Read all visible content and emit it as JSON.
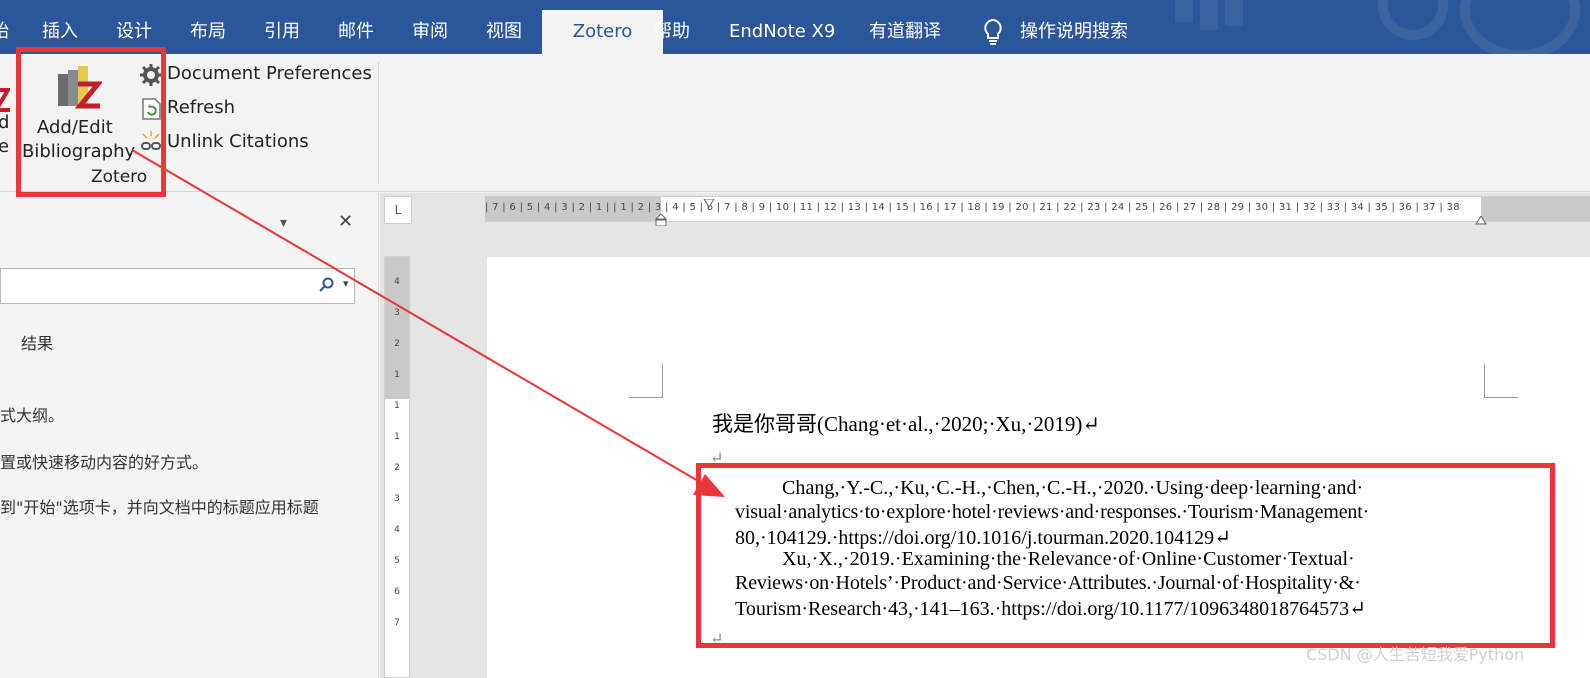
{
  "tabs": [
    "始",
    "插入",
    "设计",
    "布局",
    "引用",
    "邮件",
    "审阅",
    "视图",
    "Zotero",
    "帮助",
    "EndNote X9",
    "有道翻译",
    "操作说明搜索"
  ],
  "active_tab": "Zotero",
  "ribbon": {
    "partial_label_1": "d",
    "partial_label_2": "e",
    "add_edit_bibliography_line1": "Add/Edit",
    "add_edit_bibliography_line2": "Bibliography",
    "document_preferences": "Document Preferences",
    "refresh": "Refresh",
    "unlink_citations": "Unlink Citations",
    "group_label": "Zotero"
  },
  "nav_pane": {
    "close_glyph": "✕",
    "dropdown_glyph": "▾",
    "results_tab": "结果",
    "line1": "式大纲。",
    "line2": "置或快速移动内容的好方式。",
    "line3": "到\"开始\"选项卡，并向文档中的标题应用标题"
  },
  "ruler": {
    "horizontal_ticks": "| 7 | 6 | 5 | 4 | 3 | 2 | 1 |   | 1 | 2 | 3 | 4 | 5 | 6 | 7 | 8 | 9 | 10 | 11 | 12 | 13 | 14 | 15 | 16 | 17 | 18 | 19 | 20 | 21 | 22 | 23 | 24 | 25 | 26 | 27 | 28 | 29 | 30 | 31 | 32 | 33 | 34 | 35 | 36 | 37 | 38",
    "vertical_ticks": [
      "4",
      "3",
      "2",
      "1",
      "",
      "1",
      "1",
      "2",
      "3",
      "4",
      "5",
      "6",
      "7",
      "8"
    ],
    "tab_selector": "L"
  },
  "document": {
    "line1": "我是你哥哥(Chang·et·al.,·2020;·Xu,·2019)↵",
    "empty_para": "↵",
    "ref1_l1": "Chang,·Y.-C.,·Ku,·C.-H.,·Chen,·C.-H.,·2020.·Using·deep·learning·and·",
    "ref1_l2": "visual·analytics·to·explore·hotel·reviews·and·responses.·Tourism·Management·",
    "ref1_l3": "80,·104129.·https://doi.org/10.1016/j.tourman.2020.104129↵",
    "ref2_l1": "Xu,·X.,·2019.·Examining·the·Relevance·of·Online·Customer·Textual·",
    "ref2_l2": "Reviews·on·Hotels’·Product·and·Service·Attributes.·Journal·of·Hospitality·&·",
    "ref2_l3": "Tourism·Research·43,·141–163.·https://doi.org/10.1177/1096348018764573↵",
    "bottom_mark": "↵"
  },
  "watermark": "CSDN @人生苦短我爱Python",
  "colors": {
    "ribbon_blue": "#2b579a",
    "highlight_red": "#e8363a"
  }
}
